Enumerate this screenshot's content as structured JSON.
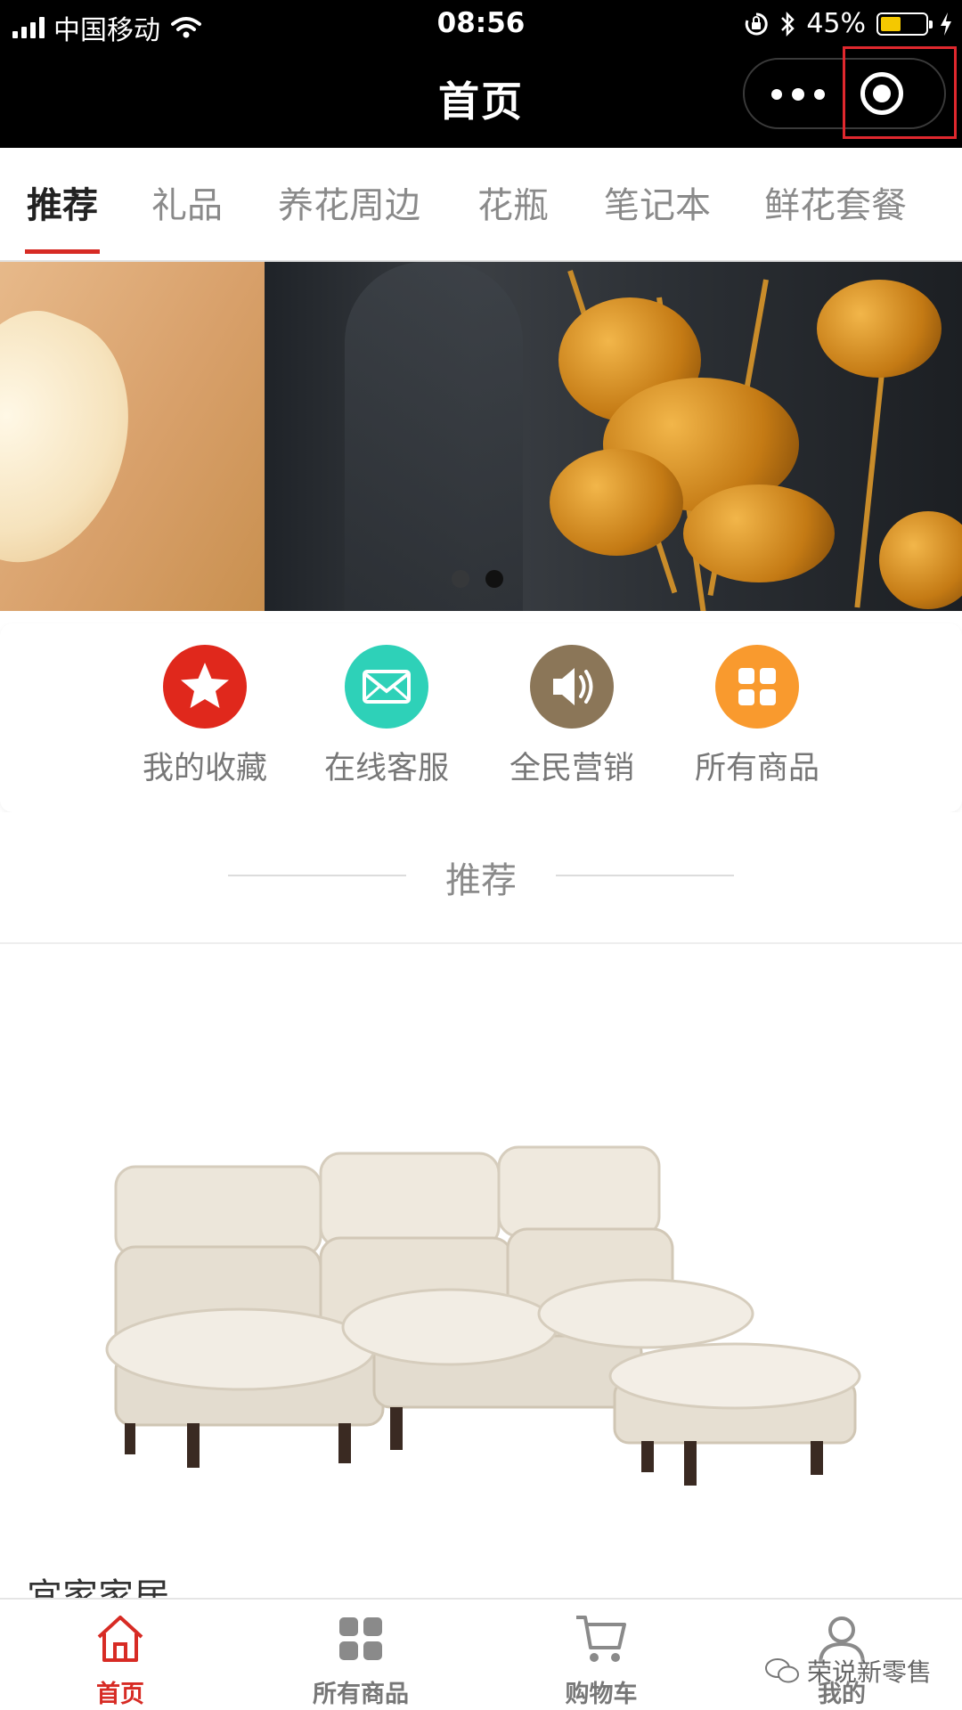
{
  "status_bar": {
    "carrier": "中国移动",
    "time": "08:56",
    "battery_percent": "45%",
    "battery_level": 0.45,
    "battery_color": "#f5c800"
  },
  "nav": {
    "title": "首页",
    "more_icon": "more-dots-icon",
    "close_icon": "target-circle-icon"
  },
  "tabs": [
    {
      "label": "推荐",
      "active": true
    },
    {
      "label": "礼品",
      "active": false
    },
    {
      "label": "养花周边",
      "active": false
    },
    {
      "label": "花瓶",
      "active": false
    },
    {
      "label": "笔记本",
      "active": false
    },
    {
      "label": "鲜花套餐",
      "active": false
    }
  ],
  "banner": {
    "dot_count": 2,
    "active_dot": 2
  },
  "quick_actions": [
    {
      "label": "我的收藏",
      "icon": "star-icon",
      "color": "#e0281c"
    },
    {
      "label": "在线客服",
      "icon": "mail-icon",
      "color": "#2ed1b8"
    },
    {
      "label": "全民营销",
      "icon": "speaker-icon",
      "color": "#8b7658"
    },
    {
      "label": "所有商品",
      "icon": "grid-icon",
      "color": "#f99a2e"
    }
  ],
  "section": {
    "title": "推荐"
  },
  "product": {
    "name": "宜家家居"
  },
  "tabbar": [
    {
      "label": "首页",
      "icon": "home-icon",
      "active": true
    },
    {
      "label": "所有商品",
      "icon": "grid-icon",
      "active": false
    },
    {
      "label": "购物车",
      "icon": "cart-icon",
      "active": false
    },
    {
      "label": "我的",
      "icon": "user-icon",
      "active": false
    }
  ],
  "watermark": {
    "text": "荣说新零售"
  },
  "colors": {
    "accent": "#d72b24",
    "nav_bg": "#000000"
  }
}
